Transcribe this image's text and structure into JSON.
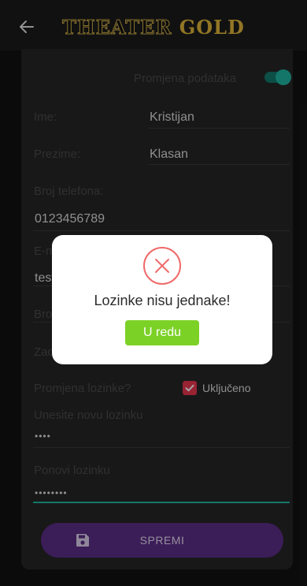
{
  "header": {
    "title_part1": "THEATER",
    "title_part2": "GOLD"
  },
  "form": {
    "toggle_label": "Promjena podataka",
    "toggle_on": true,
    "ime_label": "Ime:",
    "ime_value": "Kristijan",
    "prezime_label": "Prezime:",
    "prezime_value": "Klasan",
    "phone_label": "Broj telefona:",
    "phone_value": "0123456789",
    "email_label": "E-mail:",
    "email_value": "test",
    "brd_label": "Broj",
    "zad_label": "Zadnja",
    "password_change_label": "Promjena lozinke?",
    "checkbox_label": "Uključeno",
    "checkbox_checked": true,
    "new_password_label": "Unesite novu lozinku",
    "new_password_value": "••••",
    "repeat_password_label": "Ponovi lozinku",
    "repeat_password_value": "••••••••",
    "save_label": "SPREMI"
  },
  "dialog": {
    "message": "Lozinke nisu jednake!",
    "ok_label": "U redu"
  },
  "colors": {
    "accent_teal": "#1fb5a2",
    "save_purple": "#5b2d87",
    "ok_green": "#7cd127",
    "error_red": "#f06a6a"
  }
}
